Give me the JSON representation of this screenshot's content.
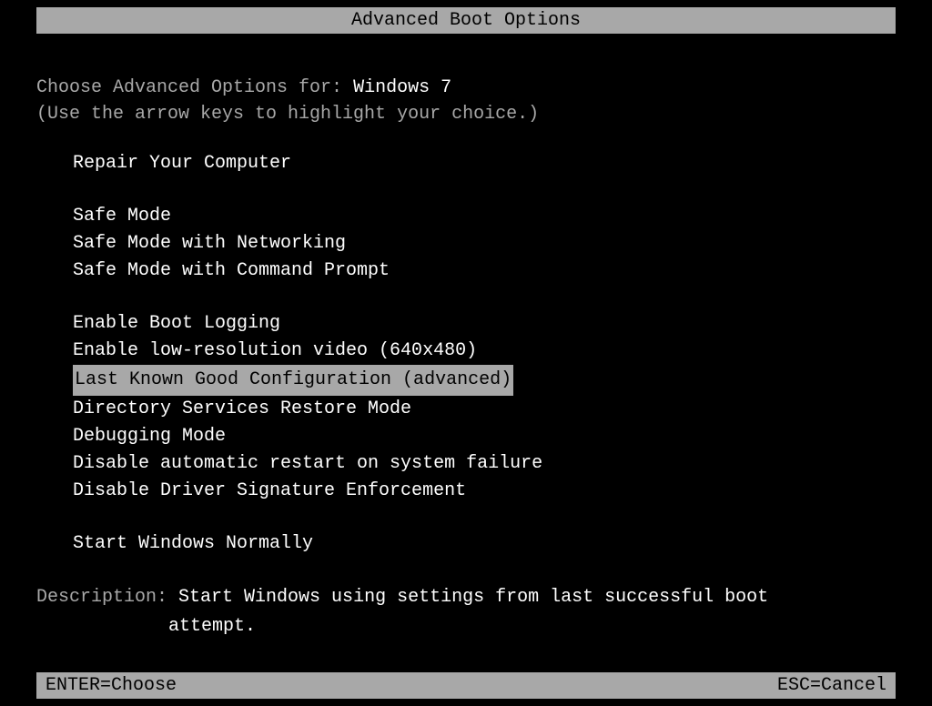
{
  "title": "Advanced Boot Options",
  "prompt_prefix": "Choose Advanced Options for: ",
  "os_name": "Windows 7",
  "instruction": "(Use the arrow keys to highlight your choice.)",
  "groups": [
    {
      "items": [
        {
          "label": "Repair Your Computer",
          "selected": false
        }
      ]
    },
    {
      "items": [
        {
          "label": "Safe Mode",
          "selected": false
        },
        {
          "label": "Safe Mode with Networking",
          "selected": false
        },
        {
          "label": "Safe Mode with Command Prompt",
          "selected": false
        }
      ]
    },
    {
      "items": [
        {
          "label": "Enable Boot Logging",
          "selected": false
        },
        {
          "label": "Enable low-resolution video (640x480)",
          "selected": false
        },
        {
          "label": "Last Known Good Configuration (advanced)",
          "selected": true
        },
        {
          "label": "Directory Services Restore Mode",
          "selected": false
        },
        {
          "label": "Debugging Mode",
          "selected": false
        },
        {
          "label": "Disable automatic restart on system failure",
          "selected": false
        },
        {
          "label": "Disable Driver Signature Enforcement",
          "selected": false
        }
      ]
    },
    {
      "items": [
        {
          "label": "Start Windows Normally",
          "selected": false
        }
      ]
    }
  ],
  "description_label": "Description: ",
  "description_line1": "Start Windows using settings from last successful boot",
  "description_line2": "attempt.",
  "footer_enter": "ENTER=Choose",
  "footer_esc": "ESC=Cancel"
}
